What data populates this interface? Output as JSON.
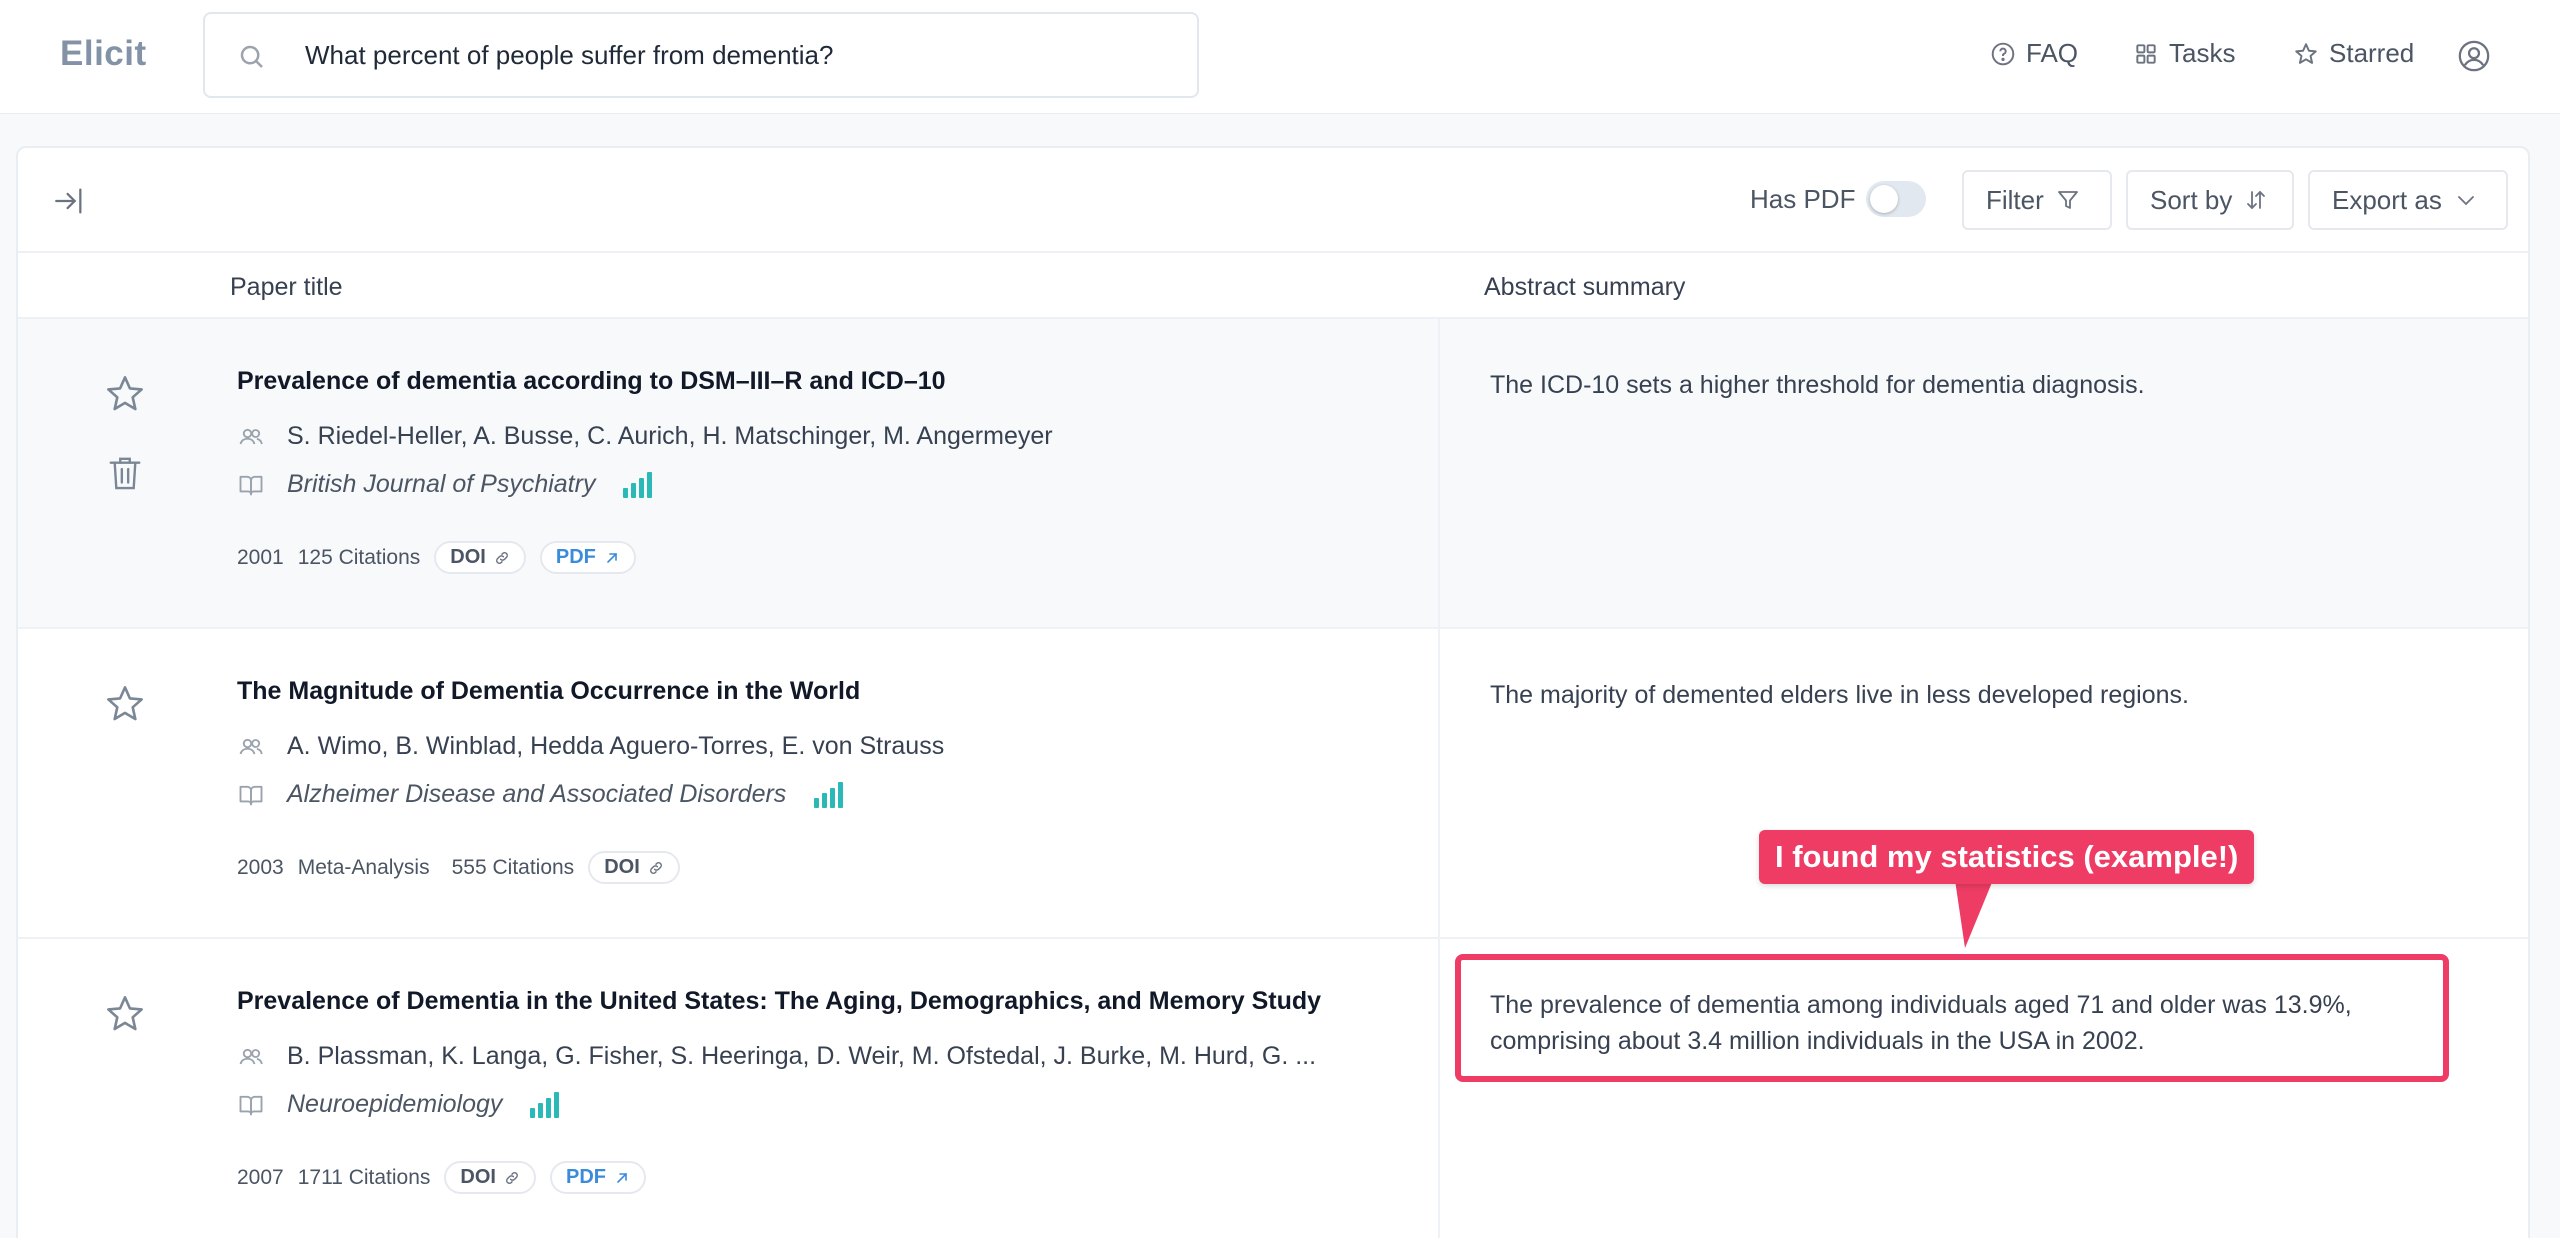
{
  "app": {
    "name": "Elicit"
  },
  "search": {
    "query": "What percent of people suffer from dementia?"
  },
  "nav": {
    "faq": "FAQ",
    "tasks": "Tasks",
    "starred": "Starred"
  },
  "toolbar": {
    "has_pdf_label": "Has PDF",
    "has_pdf_enabled": false,
    "filter_label": "Filter",
    "sort_label": "Sort by",
    "export_label": "Export as"
  },
  "columns": {
    "title": "Paper title",
    "abstract": "Abstract summary"
  },
  "papers": [
    {
      "title": "Prevalence of dementia according to DSM–III–R and ICD–10",
      "authors": "S. Riedel-Heller, A. Busse, C. Aurich, H. Matschinger, M. Angermeyer",
      "journal": "British Journal of Psychiatry",
      "year": "2001",
      "study_type": "",
      "citations": "125 Citations",
      "doi_label": "DOI",
      "pdf_label": "PDF",
      "abstract": "The ICD-10 sets a higher threshold for dementia diagnosis."
    },
    {
      "title": "The Magnitude of Dementia Occurrence in the World",
      "authors": "A. Wimo, B. Winblad, Hedda Aguero-Torres, E. von Strauss",
      "journal": "Alzheimer Disease and Associated Disorders",
      "year": "2003",
      "study_type": "Meta-Analysis",
      "citations": "555 Citations",
      "doi_label": "DOI",
      "pdf_label": "",
      "abstract": "The majority of demented elders live in less developed regions."
    },
    {
      "title": "Prevalence of Dementia in the United States: The Aging, Demographics, and Memory Study",
      "authors": "B. Plassman, K. Langa, G. Fisher, S. Heeringa, D. Weir, M. Ofstedal, J. Burke, M. Hurd, G. ...",
      "journal": "Neuroepidemiology",
      "year": "2007",
      "study_type": "",
      "citations": "1711 Citations",
      "doi_label": "DOI",
      "pdf_label": "PDF",
      "abstract": "The prevalence of dementia among individuals aged 71 and older was 13.9%, comprising about 3.4 million individuals in the USA in 2002."
    }
  ],
  "annotation": {
    "text": "I found my statistics (example!)",
    "color": "#ee3c64"
  },
  "colors": {
    "accent_teal": "#2ab9b6",
    "pdf_blue": "#3b8bdb",
    "logo": "#8392a7"
  }
}
